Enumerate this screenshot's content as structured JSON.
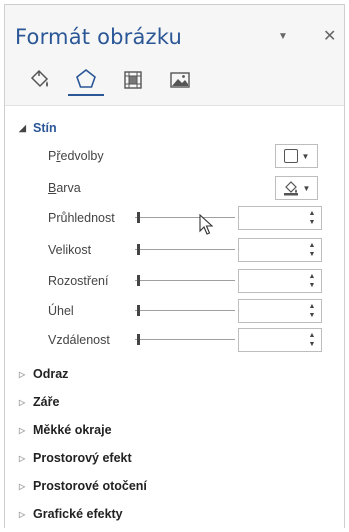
{
  "pane": {
    "title": "Formát obrázku",
    "dropdown_icon": "chevron-down-icon",
    "close_icon": "close-icon",
    "tabs": [
      {
        "name": "fill-line",
        "icon": "paint-bucket-icon"
      },
      {
        "name": "effects",
        "icon": "pentagon-icon",
        "active": true
      },
      {
        "name": "layout-properties",
        "icon": "layout-grid-icon"
      },
      {
        "name": "picture",
        "icon": "picture-icon"
      }
    ]
  },
  "shadow": {
    "heading": "Stín",
    "rows": {
      "presets": {
        "label": "Předvolby",
        "underline_char": "ř"
      },
      "color": {
        "label": "Barva",
        "underline_char": "B"
      },
      "transparency": {
        "label": "Průhlednost",
        "value": ""
      },
      "size": {
        "label": "Velikost",
        "value": ""
      },
      "blur": {
        "label": "Rozostření",
        "value": ""
      },
      "angle": {
        "label": "Úhel",
        "value": ""
      },
      "distance": {
        "label": "Vzdálenost",
        "value": ""
      }
    }
  },
  "sections": [
    {
      "label": "Odraz"
    },
    {
      "label": "Záře"
    },
    {
      "label": "Měkké okraje"
    },
    {
      "label": "Prostorový efekt"
    },
    {
      "label": "Prostorové otočení"
    },
    {
      "label": "Grafické efekty"
    }
  ],
  "colors": {
    "accent": "#2b5797",
    "pane_bg": "#f6f6f6",
    "content_bg": "#ffffff"
  }
}
